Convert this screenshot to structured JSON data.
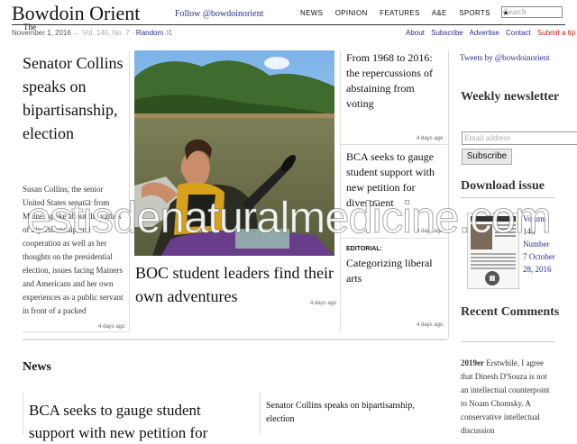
{
  "masthead": {
    "logo": "Bowdoin Orient",
    "logo_the": "The",
    "follow": "Follow @bowdoinorient",
    "nav": [
      "NEWS",
      "OPINION",
      "FEATURES",
      "A&E",
      "SPORTS",
      "★"
    ],
    "search_placeholder": "Search",
    "date": "November 1, 2016",
    "volume": "Vol. 146, No. 7",
    "random": "Random",
    "utility": [
      "About",
      "Subscribe",
      "Advertise",
      "Contact"
    ],
    "submit_tip": "Submit a tip"
  },
  "lead": {
    "headline": "Senator Collins speaks on bipartisanship, election",
    "summary": "Susan Collins, the senior United States senator from Maine, spoke about the values of bipartisanship and cooperation as well as her thoughts on the presidential election, issues facing Mainers and Americans and her own experiences as a public servant in front of a packed",
    "time": "4 days ago"
  },
  "feature": {
    "headline": "BOC student leaders find their own adventures",
    "time": "4 days ago"
  },
  "middle": [
    {
      "label": "",
      "headline": "From 1968 to 2016: the repercussions of abstaining from voting",
      "time": "4 days ago"
    },
    {
      "label": "",
      "headline": "BCA seeks to gauge student support with new petition for divestment",
      "time": "4 days ago"
    },
    {
      "label": "EDITORIAL:",
      "headline": "Categorizing liberal arts",
      "time": "4 days ago"
    }
  ],
  "sidebar": {
    "tweets": "Tweets by @bowdoinorient",
    "weekly": "Weekly newsletter",
    "email_placeholder": "Email address",
    "subscribe": "Subscribe",
    "download": "Download issue",
    "issue": "Volume 146 Number 7 October 28, 2016",
    "recent": "Recent Comments",
    "comment_author": "2019er",
    "comment_text": "Erstwhile, I agree that Dinesh D'Souza is not an intellectual counterpoint to Noam Chomsky. A conservative intellectual discussion"
  },
  "news": {
    "label": "News",
    "story1": "BCA seeks to gauge student support with new petition for",
    "story2": "Senator Collins speaks on bipartisanship, election"
  },
  "watermark": "estisdenaturalmedicine.com",
  "colors": {
    "link": "#2c2c8c",
    "tip": "#c01818",
    "rule": "#dddddd"
  }
}
